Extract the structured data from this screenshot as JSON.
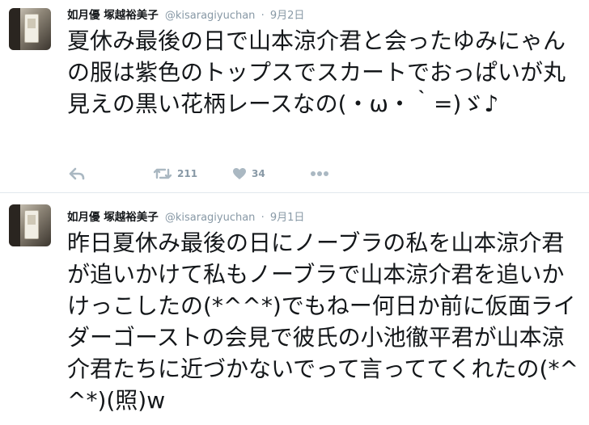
{
  "tweets": [
    {
      "display_name": "如月優 塚越裕美子",
      "handle": "@kisaragiyuchan",
      "separator": "·",
      "date": "9月2日",
      "text": "夏休み最後の日で山本涼介君と会ったゆみにゃんの服は紫色のトップスでスカートでおっぱいが丸見えの黒い花柄レースなの(・ω・｀=)ゞ♪",
      "retweets": "211",
      "likes": "34"
    },
    {
      "display_name": "如月優 塚越裕美子",
      "handle": "@kisaragiyuchan",
      "separator": "·",
      "date": "9月1日",
      "text": "昨日夏休み最後の日にノーブラの私を山本涼介君が追いかけて私もノーブラで山本涼介君を追いかけっこしたの(*^^*)でもねー何日か前に仮面ライダーゴーストの会見で彼氏の小池徹平君が山本涼介君たちに近づかないでって言っててくれたの(*^^*)(照)w"
    }
  ],
  "icons": {
    "reply": "reply-icon",
    "retweet": "retweet-icon",
    "like": "heart-icon",
    "more": "more-icon"
  },
  "colors": {
    "icon_gray": "#aab8c2",
    "meta_gray": "#8899a6",
    "divider": "#e1e8ed"
  }
}
